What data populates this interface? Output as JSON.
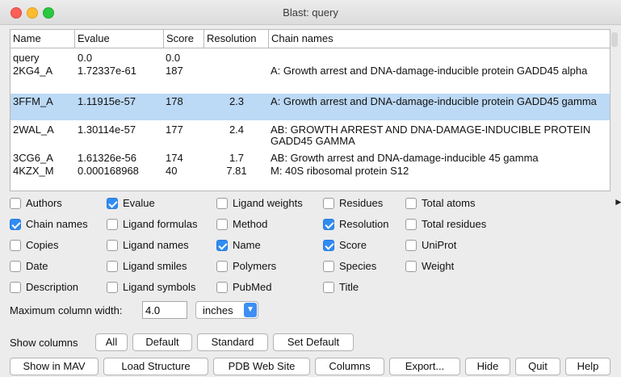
{
  "window": {
    "title": "Blast: query"
  },
  "table": {
    "columns": [
      "Name",
      "Evalue",
      "Score",
      "Resolution",
      "Chain names"
    ],
    "rows": [
      {
        "name": "query",
        "evalue": "0.0",
        "score": "0.0",
        "resolution": "",
        "chain_names": "",
        "selected": false
      },
      {
        "name": "2KG4_A",
        "evalue": "1.72337e-61",
        "score": "187",
        "resolution": "",
        "chain_names": "A: Growth arrest and DNA-damage-inducible protein GADD45 alpha",
        "selected": false
      },
      {
        "name": "3FFM_A",
        "evalue": "1.11915e-57",
        "score": "178",
        "resolution": "2.3",
        "chain_names": "A: Growth arrest and DNA-damage-inducible protein GADD45 gamma",
        "selected": true
      },
      {
        "name": "2WAL_A",
        "evalue": "1.30114e-57",
        "score": "177",
        "resolution": "2.4",
        "chain_names": "AB: GROWTH ARREST AND DNA-DAMAGE-INDUCIBLE PROTEIN GADD45 GAMMA",
        "selected": false
      },
      {
        "name": "3CG6_A",
        "evalue": "1.61326e-56",
        "score": "174",
        "resolution": "1.7",
        "chain_names": "AB: Growth arrest and DNA-damage-inducible 45 gamma",
        "selected": false
      },
      {
        "name": "4KZX_M",
        "evalue": "0.000168968",
        "score": "40",
        "resolution": "7.81",
        "chain_names": "M: 40S ribosomal protein S12",
        "selected": false
      }
    ]
  },
  "checkboxes": {
    "authors": {
      "label": "Authors",
      "checked": false
    },
    "chain_names": {
      "label": "Chain names",
      "checked": true
    },
    "copies": {
      "label": "Copies",
      "checked": false
    },
    "date": {
      "label": "Date",
      "checked": false
    },
    "description": {
      "label": "Description",
      "checked": false
    },
    "evalue": {
      "label": "Evalue",
      "checked": true
    },
    "ligand_formulas": {
      "label": "Ligand formulas",
      "checked": false
    },
    "ligand_names": {
      "label": "Ligand names",
      "checked": false
    },
    "ligand_smiles": {
      "label": "Ligand smiles",
      "checked": false
    },
    "ligand_symbols": {
      "label": "Ligand symbols",
      "checked": false
    },
    "ligand_weights": {
      "label": "Ligand weights",
      "checked": false
    },
    "method": {
      "label": "Method",
      "checked": false
    },
    "name": {
      "label": "Name",
      "checked": true
    },
    "polymers": {
      "label": "Polymers",
      "checked": false
    },
    "pubmed": {
      "label": "PubMed",
      "checked": false
    },
    "residues": {
      "label": "Residues",
      "checked": false
    },
    "resolution": {
      "label": "Resolution",
      "checked": true
    },
    "score": {
      "label": "Score",
      "checked": true
    },
    "species": {
      "label": "Species",
      "checked": false
    },
    "title": {
      "label": "Title",
      "checked": false
    },
    "total_atoms": {
      "label": "Total atoms",
      "checked": false
    },
    "total_residues": {
      "label": "Total residues",
      "checked": false
    },
    "uniprot": {
      "label": "UniProt",
      "checked": false
    },
    "weight": {
      "label": "Weight",
      "checked": false
    }
  },
  "max_width": {
    "label": "Maximum column width:",
    "value": "4.0",
    "unit": "inches"
  },
  "show_columns": {
    "label": "Show columns",
    "buttons": {
      "all": "All",
      "default": "Default",
      "standard": "Standard",
      "set_default": "Set Default"
    }
  },
  "bottom_buttons": {
    "show_in_mav": "Show in MAV",
    "load_structure": "Load Structure",
    "pdb_web_site": "PDB Web Site",
    "columns": "Columns",
    "export": "Export...",
    "hide": "Hide",
    "quit": "Quit",
    "help": "Help"
  },
  "colors": {
    "selection": "#bcd9f5",
    "checkbox_on": "#2f8cf4"
  },
  "icons": {
    "expand_arrow": "chevron-right-icon",
    "dropdown_arrow": "chevron-down-icon"
  }
}
